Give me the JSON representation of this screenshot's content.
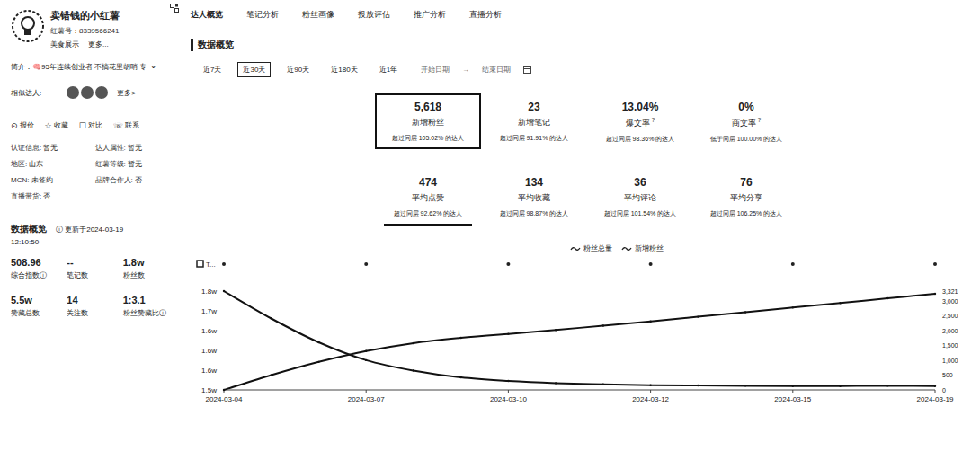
{
  "profile": {
    "name": "卖错钱的小红薯",
    "redId": "红薯号：8339566241",
    "links": [
      "美食展示",
      "更多..."
    ],
    "bio": "简介：🧠95年连续创业者 不搞花里胡哨 专",
    "bioToggle": "⌄",
    "similarLabel": "相似达人:",
    "similarMore": "更多>",
    "actions": [
      {
        "icon": "⊙",
        "label": "报价"
      },
      {
        "icon": "☆",
        "label": "收藏"
      },
      {
        "icon": "☐",
        "label": "对比"
      },
      {
        "icon": "☏",
        "label": "联系"
      }
    ],
    "info": [
      {
        "label": "认证信息:",
        "value": "暂无"
      },
      {
        "label": "达人属性:",
        "value": "暂无"
      },
      {
        "label": "地区:",
        "value": "山东"
      },
      {
        "label": "红薯等级:",
        "value": "暂无"
      },
      {
        "label": "MCN:",
        "value": "未签约"
      },
      {
        "label": "品牌合作人:",
        "value": "否"
      },
      {
        "label": "直播带货:",
        "value": "否"
      }
    ]
  },
  "overview": {
    "title": "数据概览",
    "infoIcon": "ⓘ",
    "updated": "更新于2024-03-19",
    "time": "12:10:50",
    "stats": [
      {
        "value": "508.96",
        "label": "综合指数",
        "info": "ⓘ"
      },
      {
        "value": "--",
        "label": "笔记数"
      },
      {
        "value": "1.8w",
        "label": "粉丝数"
      },
      {
        "value": "5.5w",
        "label": "赞藏总数"
      },
      {
        "value": "14",
        "label": "关注数"
      },
      {
        "value": "1:3.1",
        "label": "粉丝赞藏比",
        "info": "ⓘ"
      }
    ]
  },
  "tabs": [
    {
      "label": "达人概览",
      "selected": true
    },
    {
      "label": "笔记分析",
      "selected": false
    },
    {
      "label": "粉丝画像",
      "selected": false
    },
    {
      "label": "投放评估",
      "selected": false
    },
    {
      "label": "推广分析",
      "selected": false
    },
    {
      "label": "直播分析",
      "selected": false
    }
  ],
  "section": {
    "title": "数据概览"
  },
  "ranges": [
    {
      "label": "近7天",
      "selected": false
    },
    {
      "label": "近30天",
      "selected": true
    },
    {
      "label": "近90天",
      "selected": false
    },
    {
      "label": "近180天",
      "selected": false
    },
    {
      "label": "近1年",
      "selected": false
    }
  ],
  "dateRange": {
    "start": "开始日期",
    "separator": "→",
    "end": "结束日期"
  },
  "metrics": [
    {
      "value": "5,618",
      "label": "新增粉丝",
      "compare": "超过同层 105.02% 的达人",
      "selected": true,
      "underlined": false
    },
    {
      "value": "23",
      "label": "新增笔记",
      "compare": "超过同层 91.91% 的达人",
      "selected": false,
      "underlined": false
    },
    {
      "value": "13.04%",
      "label": "爆文率",
      "hint": "?",
      "compare": "超过同层 98.36% 的达人",
      "selected": false,
      "underlined": false
    },
    {
      "value": "0%",
      "label": "商文率",
      "hint": "?",
      "compare": "低于同层 100.00% 的达人",
      "selected": false,
      "underlined": false
    },
    {
      "value": "474",
      "label": "平均点赞",
      "compare": "超过同层 92.62% 的达人",
      "selected": false,
      "underlined": true
    },
    {
      "value": "134",
      "label": "平均收藏",
      "compare": "超过同层 98.87% 的达人",
      "selected": false,
      "underlined": false
    },
    {
      "value": "36",
      "label": "平均评论",
      "compare": "超过同层 101.54% 的达人",
      "selected": false,
      "underlined": false
    },
    {
      "value": "76",
      "label": "平均分享",
      "compare": "超过同层 106.25% 的达人",
      "selected": false,
      "underlined": false
    }
  ],
  "chart": {
    "markerLabel": "T...",
    "series": [
      {
        "name": "粉丝总量",
        "axis": "left",
        "values": [
          15000,
          15450,
          15850,
          16180,
          16420,
          16580,
          16700,
          16820,
          16950,
          17080,
          17220,
          17360,
          17500,
          17640,
          17780,
          17920
        ]
      },
      {
        "name": "新增粉丝",
        "axis": "right",
        "values": [
          3321,
          2400,
          1600,
          1000,
          650,
          420,
          300,
          230,
          190,
          160,
          150,
          140,
          130,
          130,
          140,
          130
        ]
      }
    ],
    "leftAxis": {
      "min": 15000,
      "max": 18000,
      "ticks": [
        "1.8w",
        "1.7w",
        "1.6w",
        "1.6w",
        "1.6w",
        "1.5w"
      ]
    },
    "rightAxis": {
      "min": 0,
      "max": 3321,
      "ticks": [
        {
          "label": "3,321",
          "value": 3321
        },
        {
          "label": "3,000",
          "value": 3000
        },
        {
          "label": "2,500",
          "value": 2500
        },
        {
          "label": "2,000",
          "value": 2000
        },
        {
          "label": "1,500",
          "value": 1500
        },
        {
          "label": "1,000",
          "value": 1000
        },
        {
          "label": "500",
          "value": 500
        },
        {
          "label": "0",
          "value": 0
        }
      ]
    },
    "xLabels": [
      "2024-03-04",
      "2024-03-07",
      "2024-03-10",
      "2024-03-12",
      "2024-03-15",
      "2024-03-19"
    ]
  }
}
